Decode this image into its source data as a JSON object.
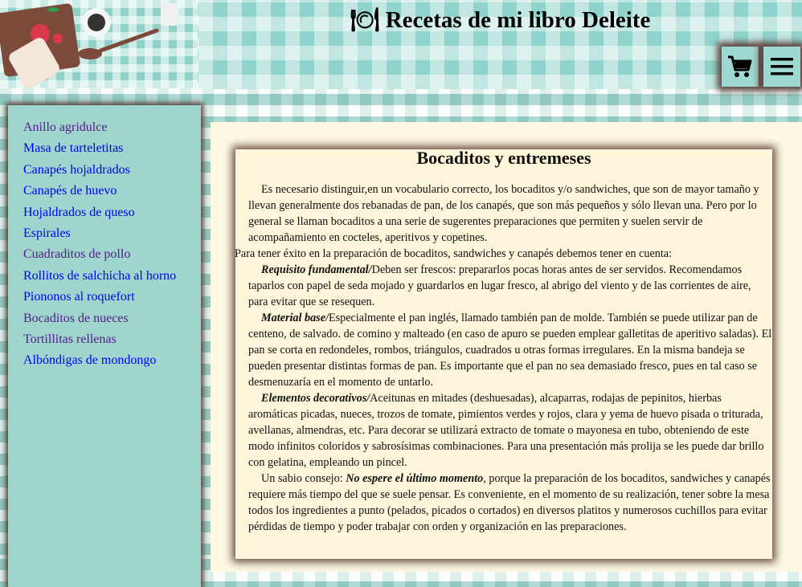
{
  "header": {
    "title": "🍽 Recetas de mi libro Deleite",
    "cart_icon": "cart-icon",
    "menu_icon": "hamburger-menu-icon"
  },
  "sidebar": {
    "items": [
      {
        "label": "Anillo agridulce",
        "color": "#551a8b"
      },
      {
        "label": "Masa de tarteletitas",
        "color": "#0000ee"
      },
      {
        "label": "Canapés hojaldrados",
        "color": "#0000ee"
      },
      {
        "label": "Canapés de huevo",
        "color": "#0000ee"
      },
      {
        "label": "Hojaldrados de queso",
        "color": "#0000ee"
      },
      {
        "label": "Espirales",
        "color": "#0000ee"
      },
      {
        "label": "Cuadraditos de pollo",
        "color": "#551a8b"
      },
      {
        "label": "Rollitos de salchicha al horno",
        "color": "#0000ee"
      },
      {
        "label": "Piononos al roquefort",
        "color": "#0000ee"
      },
      {
        "label": "Bocaditos de nueces",
        "color": "#551a8b"
      },
      {
        "label": "Tortillitas rellenas",
        "color": "#551a8b"
      },
      {
        "label": "Albóndigas de mondongo",
        "color": "#0000ee"
      }
    ]
  },
  "article": {
    "title": "Bocaditos y entremeses",
    "p1": "Es necesario distinguir,en un vocabulario correcto, los bocaditos y/o sandwiches, que son de mayor tamaño y llevan generalmente dos rebanadas de pan, de los canapés, que son más pequeños y sólo llevan una. Pero por lo general se llaman bocaditos a una serie de sugerentes preparaciones que permiten y suelen servir de acompañamiento en cocteles, aperitivos y copetines.",
    "p2": "Para tener éxito en la preparación de bocaditos, sandwiches y canapés debemos tener en cuenta:",
    "p3_label": "Requisito fundamental/",
    "p3_text": "Deben ser frescos: prepararlos pocas horas antes de ser servidos. Recomendamos taparlos con papel de seda mojado y guardarlos en lugar fresco, al abrigo del viento y de las corrientes de aire, para evitar que se resequen.",
    "p4_label": "Material base/",
    "p4_text": "Especialmente el pan inglés, llamado también pan de molde. También se puede utilizar pan de centeno, de salvado. de comino y malteado (en caso de apuro se pueden emplear galletitas de aperitivo saladas). El pan se corta en redondeles, rombos, triángulos, cuadrados u otras formas irregulares. En la misma bandeja se pueden presentar distintas formas de pan. Es importante que el pan no sea demasiado fresco, pues en tal caso se desmenuzaría en el momento de untarlo.",
    "p5_label": "Elementos decorativos/",
    "p5_text": "Aceitunas en mitades (deshuesadas), alcaparras, rodajas de pepinitos, hierbas aromáticas picadas, nueces, trozos de tomate, pimientos verdes y rojos, clara y yema de huevo pisada o triturada, avellanas, almendras, etc. Para decorar se utilizará extracto de tomate o mayonesa en tubo, obteniendo de este modo infinitos coloridos y sabrosísimas combinaciones. Para una presentación más prolija se les puede dar brillo con gelatina, empleando un pincel.",
    "p6_lead": "Un sabio consejo: ",
    "p6_emphasis": "No espere el último momento",
    "p6_text": ", porque la preparación de los bocaditos, sandwiches y canapés requiere más tiempo del que se suele pensar. Es conveniente, en el momento de su realización, tener sobre la mesa todos los ingredientes a punto (pelados, picados o cortados) en diversos platitos y numerosos cuchillos para evitar pérdidas de tiempo y poder trabajar con orden y organización en las preparaciones."
  },
  "colors": {
    "teal": "#9ed6ce",
    "brown_shadow": "#5a3a34",
    "panel_cream": "#fdf6da",
    "link_unvisited": "#0000ee",
    "link_visited": "#551a8b"
  }
}
